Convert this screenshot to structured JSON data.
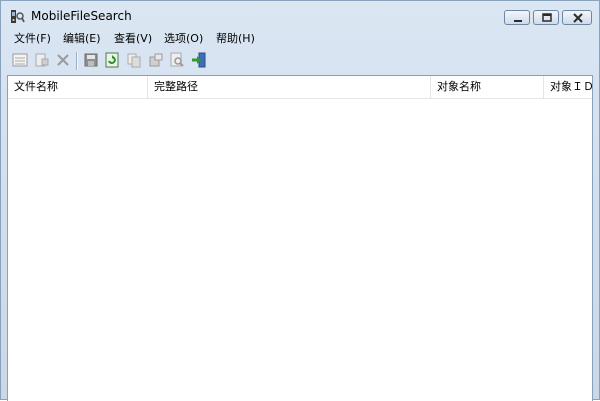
{
  "window": {
    "title": "MobileFileSearch"
  },
  "titlebar_buttons": {
    "minimize": "minimize-icon",
    "maximize": "maximize-icon",
    "close": "close-icon"
  },
  "menubar": {
    "items": [
      {
        "label": "文件(F)"
      },
      {
        "label": "编辑(E)"
      },
      {
        "label": "查看(V)"
      },
      {
        "label": "选项(O)"
      },
      {
        "label": "帮助(H)"
      }
    ]
  },
  "toolbar": {
    "icons": [
      "list-icon",
      "add-document-icon",
      "delete-icon",
      "save-icon",
      "refresh-icon",
      "copy-icon",
      "properties-icon",
      "find-icon",
      "exit-icon"
    ]
  },
  "listview": {
    "columns": [
      "文件名称",
      "完整路径",
      "对象名称",
      "对象ＩＤ"
    ],
    "rows": []
  }
}
